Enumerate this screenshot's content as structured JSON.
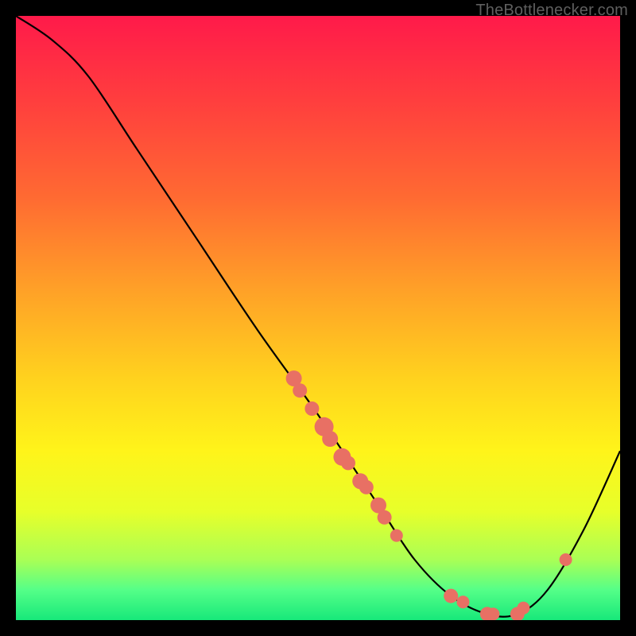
{
  "attribution": "TheBottlenecker.com",
  "chart_data": {
    "type": "line",
    "title": "",
    "xlabel": "",
    "ylabel": "",
    "xlim": [
      0,
      100
    ],
    "ylim": [
      0,
      100
    ],
    "curve": [
      {
        "x": 0,
        "y": 100
      },
      {
        "x": 6,
        "y": 96
      },
      {
        "x": 12,
        "y": 90
      },
      {
        "x": 20,
        "y": 78
      },
      {
        "x": 30,
        "y": 63
      },
      {
        "x": 40,
        "y": 48
      },
      {
        "x": 50,
        "y": 34
      },
      {
        "x": 60,
        "y": 19
      },
      {
        "x": 66,
        "y": 10
      },
      {
        "x": 72,
        "y": 4
      },
      {
        "x": 78,
        "y": 1
      },
      {
        "x": 83,
        "y": 1
      },
      {
        "x": 88,
        "y": 5
      },
      {
        "x": 94,
        "y": 15
      },
      {
        "x": 100,
        "y": 28
      }
    ],
    "markers": [
      {
        "x": 46,
        "y": 40,
        "r": 10
      },
      {
        "x": 47,
        "y": 38,
        "r": 9
      },
      {
        "x": 49,
        "y": 35,
        "r": 9
      },
      {
        "x": 51,
        "y": 32,
        "r": 12
      },
      {
        "x": 52,
        "y": 30,
        "r": 10
      },
      {
        "x": 54,
        "y": 27,
        "r": 11
      },
      {
        "x": 55,
        "y": 26,
        "r": 9
      },
      {
        "x": 57,
        "y": 23,
        "r": 10
      },
      {
        "x": 58,
        "y": 22,
        "r": 9
      },
      {
        "x": 60,
        "y": 19,
        "r": 10
      },
      {
        "x": 61,
        "y": 17,
        "r": 9
      },
      {
        "x": 63,
        "y": 14,
        "r": 8
      },
      {
        "x": 72,
        "y": 4,
        "r": 9
      },
      {
        "x": 74,
        "y": 3,
        "r": 8
      },
      {
        "x": 78,
        "y": 1,
        "r": 9
      },
      {
        "x": 79,
        "y": 1,
        "r": 8
      },
      {
        "x": 83,
        "y": 1,
        "r": 9
      },
      {
        "x": 84,
        "y": 2,
        "r": 8
      },
      {
        "x": 91,
        "y": 10,
        "r": 8
      }
    ],
    "gradient_stops": [
      {
        "offset": 0.0,
        "color": "#ff1a4a"
      },
      {
        "offset": 0.14,
        "color": "#ff3e3e"
      },
      {
        "offset": 0.3,
        "color": "#ff6a32"
      },
      {
        "offset": 0.46,
        "color": "#ffa327"
      },
      {
        "offset": 0.6,
        "color": "#ffd21e"
      },
      {
        "offset": 0.72,
        "color": "#fff41a"
      },
      {
        "offset": 0.82,
        "color": "#e7ff2a"
      },
      {
        "offset": 0.9,
        "color": "#aaff55"
      },
      {
        "offset": 0.95,
        "color": "#55ff88"
      },
      {
        "offset": 1.0,
        "color": "#17e87a"
      }
    ],
    "marker_color": "#e87064",
    "curve_color": "#000000"
  }
}
